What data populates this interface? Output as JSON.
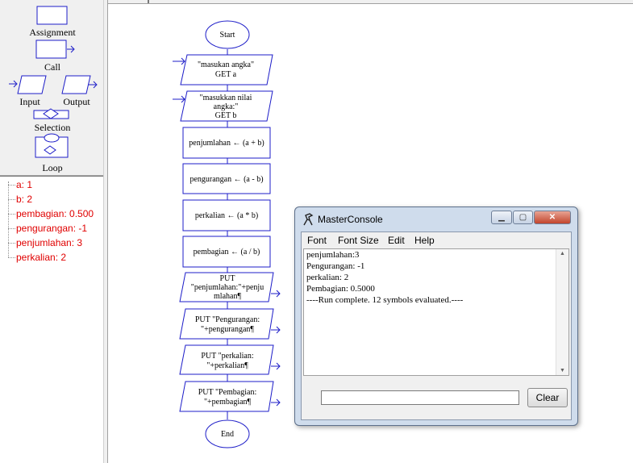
{
  "palette": {
    "items": [
      {
        "label": "Assignment"
      },
      {
        "label": "Call"
      },
      {
        "label": "Input"
      },
      {
        "label": "Output"
      },
      {
        "label": "Selection"
      },
      {
        "label": "Loop"
      }
    ]
  },
  "variables": [
    {
      "text": "a: 1"
    },
    {
      "text": "b: 2"
    },
    {
      "text": "pembagian: 0.500"
    },
    {
      "text": "pengurangan: -1"
    },
    {
      "text": "penjumlahan: 3"
    },
    {
      "text": "perkalian: 2"
    }
  ],
  "flowchart": {
    "start": "Start",
    "end": "End",
    "input1_line1": "\"masukan angka\"",
    "input1_line2": "GET a",
    "input2_line1": "\"masukkan nilai",
    "input2_line2": "angka:\"",
    "input2_line3": "GET b",
    "assign1": "penjumlahan ← (a + b)",
    "assign2": "pengurangan ← (a - b)",
    "assign3": "perkalian ← (a * b)",
    "assign4": "pembagian ← (a / b)",
    "output1_line1": "PUT",
    "output1_line2": "\"penjumlahan:\"+penju",
    "output1_line3": "mlahan¶",
    "output2_line1": "PUT \"Pengurangan:",
    "output2_line2": "\"+pengurangan¶",
    "output3_line1": "PUT \"perkalian:",
    "output3_line2": "\"+perkalian¶",
    "output4_line1": "PUT \"Pembagian:",
    "output4_line2": "\"+pembagian¶"
  },
  "console": {
    "title": "MasterConsole",
    "menu": [
      "Font",
      "Font Size",
      "Edit",
      "Help"
    ],
    "output": [
      "penjumlahan:3",
      "Pengurangan: -1",
      "perkalian: 2",
      "Pembagian: 0.5000",
      "----Run complete.  12 symbols evaluated.----"
    ],
    "input_value": "",
    "clear_label": "Clear"
  },
  "colors": {
    "flow_blue": "#1c1cc8",
    "var_red": "#e00000"
  }
}
